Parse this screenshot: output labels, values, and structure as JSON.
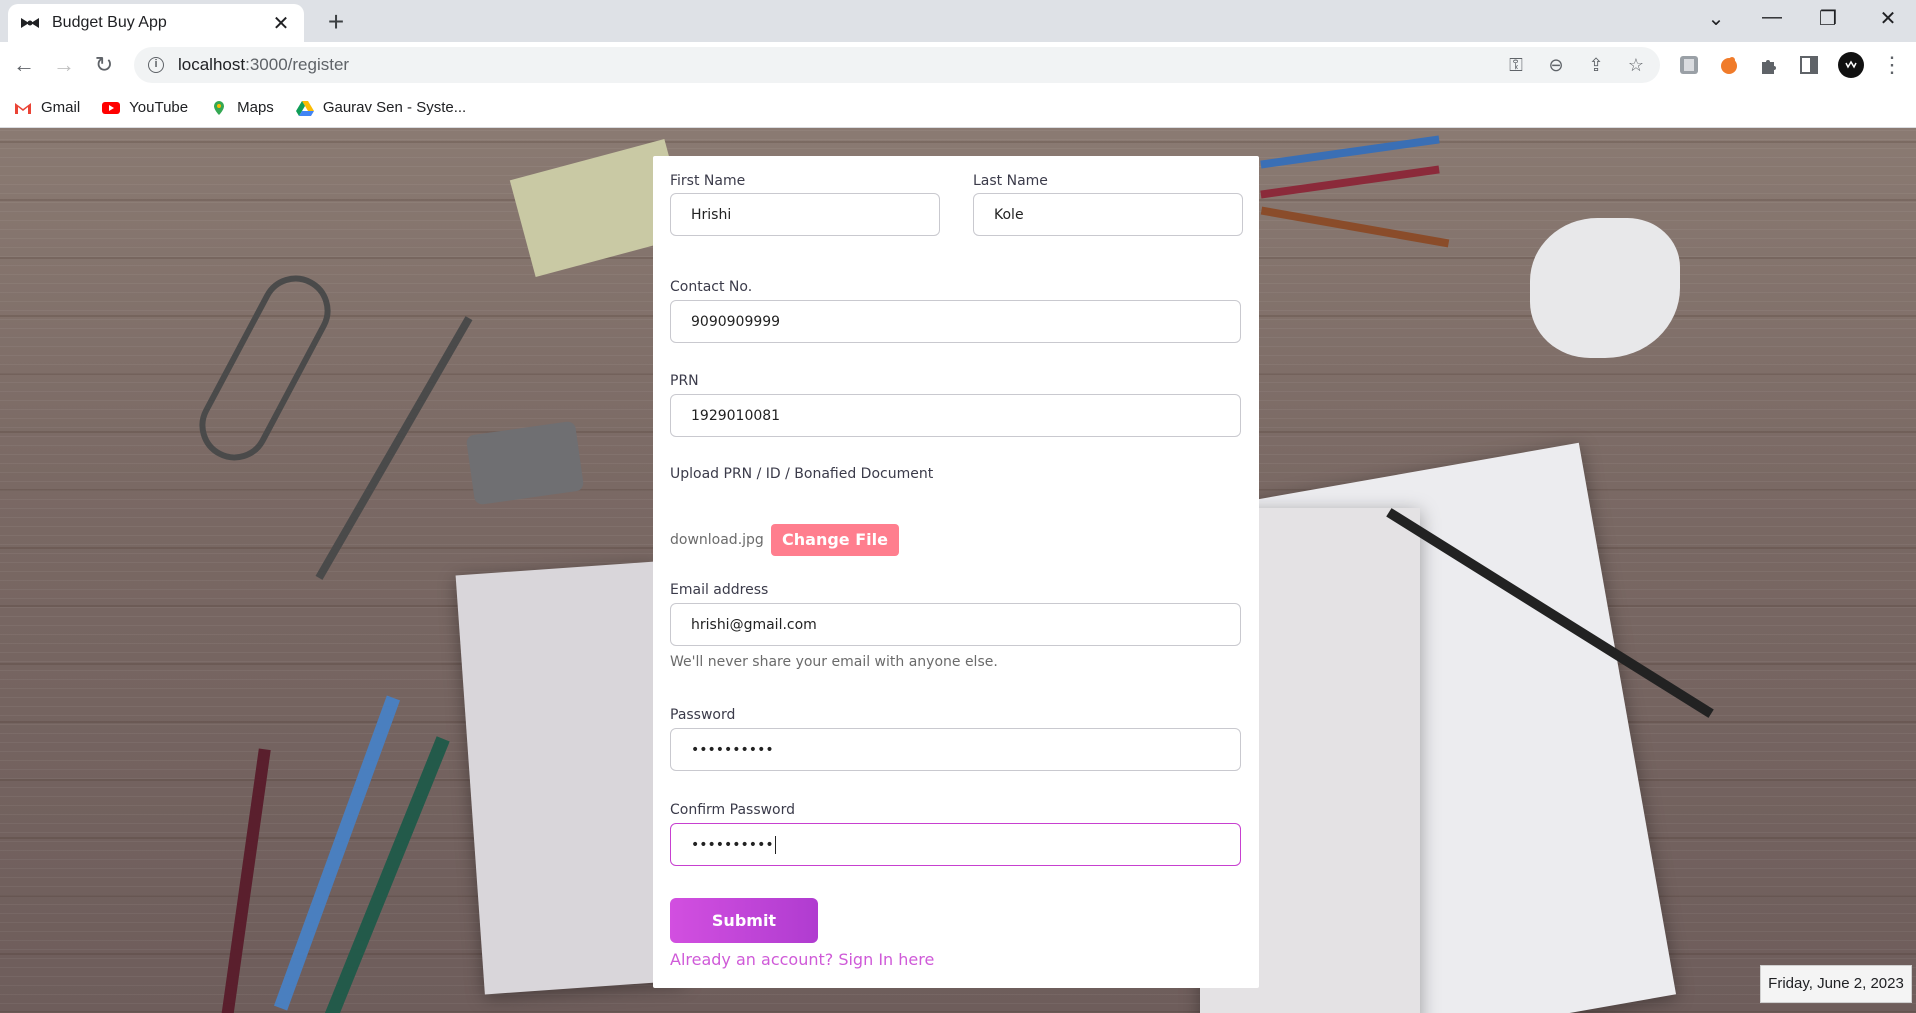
{
  "browser": {
    "tab_title": "Budget Buy App",
    "new_tab_symbol": "+",
    "url_host": "localhost",
    "url_path": ":3000/register",
    "bookmarks": [
      {
        "label": "Gmail",
        "icon": "gmail-icon"
      },
      {
        "label": "YouTube",
        "icon": "youtube-icon"
      },
      {
        "label": "Maps",
        "icon": "maps-icon"
      },
      {
        "label": "Gaurav Sen - Syste...",
        "icon": "drive-icon"
      }
    ]
  },
  "form": {
    "first_name_label": "First Name",
    "first_name_value": "Hrishi",
    "last_name_label": "Last Name",
    "last_name_value": "Kole",
    "contact_label": "Contact No.",
    "contact_value": "9090909999",
    "prn_label": "PRN",
    "prn_value": "1929010081",
    "upload_label": "Upload PRN / ID / Bonafied Document",
    "file_name": "download.jpg",
    "change_file_label": "Change File",
    "email_label": "Email address",
    "email_value": "hrishi@gmail.com",
    "email_hint": "We'll never share your email with anyone else.",
    "password_label": "Password",
    "password_value": "••••••••••",
    "confirm_label": "Confirm Password",
    "confirm_value": "••••••••••",
    "submit_label": "Submit",
    "signin_label": "Already an account? Sign In here"
  },
  "taskbar": {
    "date": "Friday, June 2, 2023"
  },
  "colors": {
    "accent": "#c740d0",
    "change_file_bg": "#ff7e8e",
    "link": "#cf5ad8"
  }
}
